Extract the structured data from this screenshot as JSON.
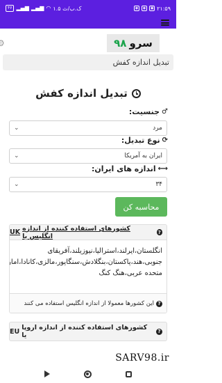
{
  "status_bar": {
    "time": "۲۱:۵۹",
    "speed": "۱.۵ ک.ب/ث",
    "battery": "۴۶",
    "signal_icon": "signal-icon",
    "wifi_icon": "wifi-icon"
  },
  "brand": {
    "logo_text": "سرو",
    "logo_num": "۹۸",
    "accent": "#5c1fe0",
    "logo_num_color": "#19a34a"
  },
  "page_header": "تبدیل اندازه کفش",
  "form": {
    "title": "تبدیل اندازه کفش",
    "gender_label": "جنسیت:",
    "gender_value": "مرد",
    "conversion_label": "نوع تبدیل:",
    "conversion_value": "ایران به آمریکا",
    "size_label": "اندازه های ایران:",
    "size_value": "۳۴",
    "calculate_button": "محاسبه کن",
    "button_color": "#5cb85c"
  },
  "uk_card": {
    "title": "کشورهای استفاده کننده از اندازه انگلیس یا",
    "title_code": "UK",
    "body": "انگلستان،ایرلند،استرالیا،نیوزیلند،آفریقای جنوبی،هند،پاکستان،بنگلادش،سنگاپور،مالزی،کانادا،امارات متحده عربی،هنگ کنگ",
    "footer": "این کشورها معمولا از اندازه انگلیس استفاده می کنند"
  },
  "eu_card": {
    "title": "کشورهای استفاده کننده از اندازه اروپا یا",
    "title_code": "EU"
  },
  "watermark": "SARV98.ir"
}
